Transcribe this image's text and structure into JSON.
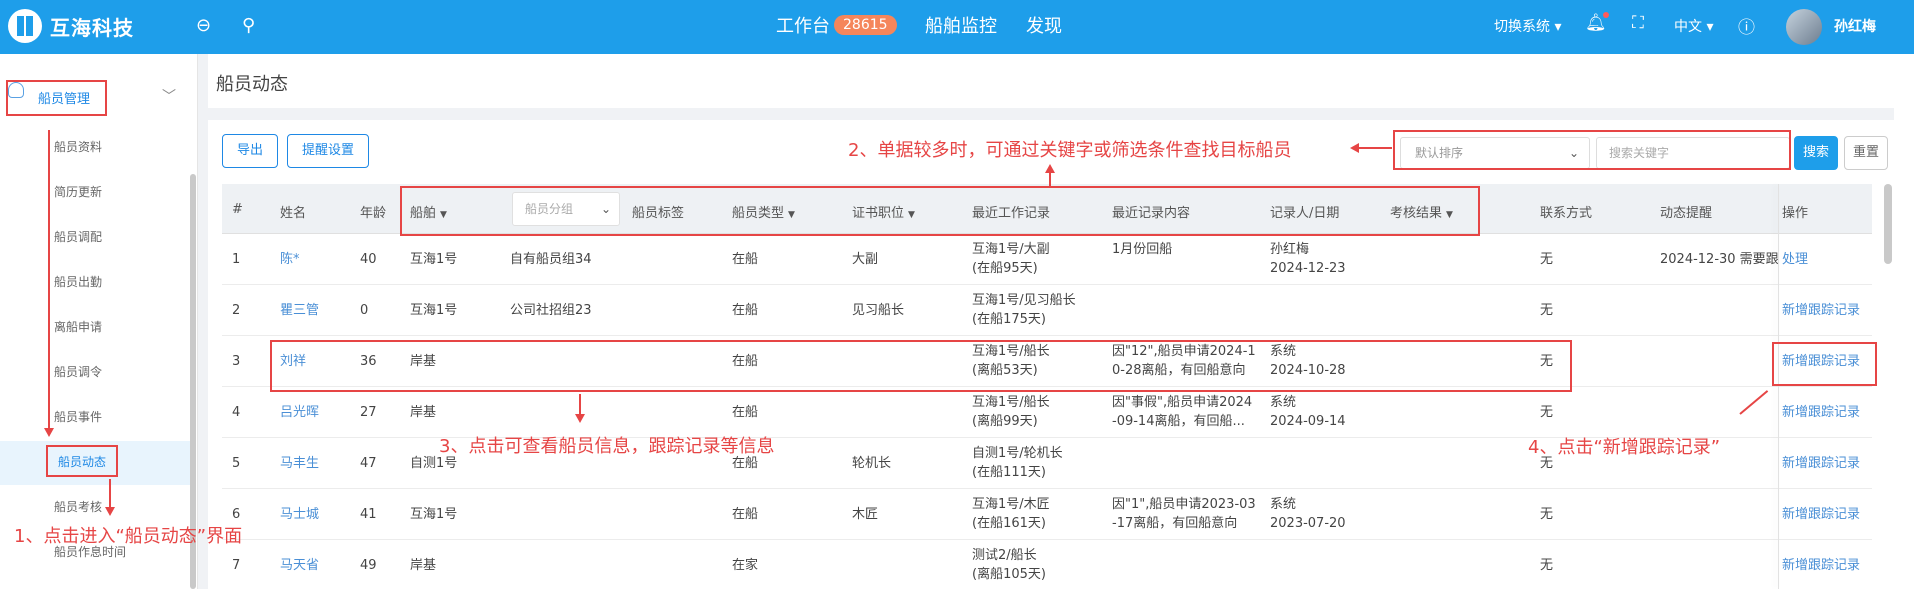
{
  "header": {
    "logo_text": "互海科技",
    "workbench_label": "工作台",
    "workbench_badge": "28615",
    "monitor_label": "船舶监控",
    "discover_label": "发现",
    "switch_system": "切换系统",
    "language": "中文",
    "user_name": "孙红梅"
  },
  "sidebar": {
    "group_label": "船员管理",
    "items": [
      "船员资料",
      "简历更新",
      "船员调配",
      "船员出勤",
      "离船申请",
      "船员调令",
      "船员事件",
      "船员动态",
      "船员考核",
      "船员作息时间"
    ]
  },
  "page": {
    "title": "船员动态",
    "export_label": "导出",
    "remind_label": "提醒设置",
    "sort_value": "默认排序",
    "search_placeholder": "搜索关键字",
    "search_btn": "搜索",
    "reset_btn": "重置",
    "group_placeholder": "船员分组"
  },
  "table": {
    "headers": {
      "idx": "#",
      "name": "姓名",
      "age": "年龄",
      "ship": "船舶",
      "tags": "船员标签",
      "type": "船员类型",
      "post": "证书职位",
      "record": "最近工作记录",
      "content": "最近记录内容",
      "recorder": "记录人/日期",
      "result": "考核结果",
      "contact": "联系方式",
      "remind": "动态提醒",
      "op": "操作"
    },
    "rows": [
      {
        "idx": "1",
        "name": "陈*",
        "age": "40",
        "ship": "互海1号",
        "group": "自有船员组34",
        "type": "在船",
        "post": "大副",
        "rec1": "互海1号/大副",
        "rec2": "(在船95天)",
        "c1": "1月份回船",
        "c2": "",
        "r1": "孙红梅",
        "r2": "2024-12-23",
        "contact": "无",
        "remind": "2024-12-30 需要跟",
        "op": "处理"
      },
      {
        "idx": "2",
        "name": "瞿三管",
        "age": "0",
        "ship": "互海1号",
        "group": "公司社招组23",
        "type": "在船",
        "post": "见习船长",
        "rec1": "互海1号/见习船长",
        "rec2": "(在船175天)",
        "c1": "",
        "c2": "",
        "r1": "",
        "r2": "",
        "contact": "无",
        "remind": "",
        "op": "新增跟踪记录"
      },
      {
        "idx": "3",
        "name": "刘祥",
        "age": "36",
        "ship": "岸基",
        "group": "",
        "type": "在船",
        "post": "",
        "rec1": "互海1号/船长",
        "rec2": "(离船53天)",
        "c1": "因\"12\",船员申请2024-1",
        "c2": "0-28离船，有回船意向",
        "r1": "系统",
        "r2": "2024-10-28",
        "contact": "无",
        "remind": "",
        "op": "新增跟踪记录"
      },
      {
        "idx": "4",
        "name": "吕光晖",
        "age": "27",
        "ship": "岸基",
        "group": "",
        "type": "在船",
        "post": "",
        "rec1": "互海1号/船长",
        "rec2": "(离船99天)",
        "c1": "因\"事假\",船员申请2024",
        "c2": "-09-14离船，有回船...",
        "r1": "系统",
        "r2": "2024-09-14",
        "contact": "无",
        "remind": "",
        "op": "新增跟踪记录"
      },
      {
        "idx": "5",
        "name": "马丰生",
        "age": "47",
        "ship": "自测1号",
        "group": "",
        "type": "在船",
        "post": "轮机长",
        "rec1": "自测1号/轮机长",
        "rec2": "(在船111天)",
        "c1": "",
        "c2": "",
        "r1": "",
        "r2": "",
        "contact": "无",
        "remind": "",
        "op": "新增跟踪记录"
      },
      {
        "idx": "6",
        "name": "马士城",
        "age": "41",
        "ship": "互海1号",
        "group": "",
        "type": "在船",
        "post": "木匠",
        "rec1": "互海1号/木匠",
        "rec2": "(在船161天)",
        "c1": "因\"1\",船员申请2023-03",
        "c2": "-17离船，有回船意向",
        "r1": "系统",
        "r2": "2023-07-20",
        "contact": "无",
        "remind": "",
        "op": "新增跟踪记录"
      },
      {
        "idx": "7",
        "name": "马天省",
        "age": "49",
        "ship": "岸基",
        "group": "",
        "type": "在家",
        "post": "",
        "rec1": "测试2/船长",
        "rec2": "(离船105天)",
        "c1": "",
        "c2": "",
        "r1": "",
        "r2": "",
        "contact": "无",
        "remind": "",
        "op": "新增跟踪记录"
      }
    ]
  },
  "annotations": {
    "step1": "1、点击进入“船员动态”界面",
    "step2": "2、单据较多时，可通过关键字或筛选条件查找目标船员",
    "step3": "3、点击可查看船员信息，跟踪记录等信息",
    "step4": "4、点击“新增跟踪记录”"
  },
  "colors": {
    "topbar": "#1e9eea",
    "annotation_red": "#e64545",
    "link": "#4a8fd6",
    "badge": "#f5865b"
  }
}
